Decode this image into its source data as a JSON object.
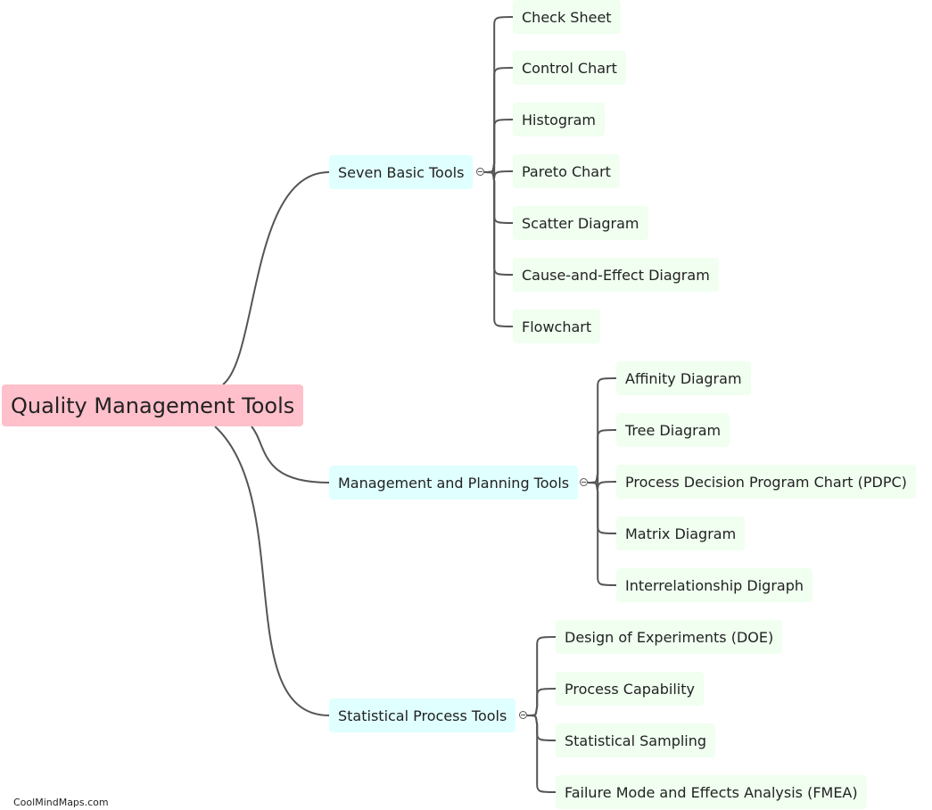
{
  "root": {
    "label": "Quality Management Tools"
  },
  "branches": [
    {
      "label": "Seven Basic Tools",
      "children": [
        "Check Sheet",
        "Control Chart",
        "Histogram",
        "Pareto Chart",
        "Scatter Diagram",
        "Cause-and-Effect Diagram",
        "Flowchart"
      ]
    },
    {
      "label": "Management and Planning Tools",
      "children": [
        "Affinity Diagram",
        "Tree Diagram",
        "Process Decision Program Chart (PDPC)",
        "Matrix Diagram",
        "Interrelationship Digraph"
      ]
    },
    {
      "label": "Statistical Process Tools",
      "children": [
        "Design of Experiments (DOE)",
        "Process Capability",
        "Statistical Sampling",
        "Failure Mode and Effects Analysis (FMEA)"
      ]
    }
  ],
  "collapse_icon": "collapse-minus-icon",
  "watermark": "CoolMindMaps.com",
  "colors": {
    "root": "#ffc0cb",
    "level1": "#e0ffff",
    "level2": "#f0fff0",
    "link": "#555555"
  }
}
